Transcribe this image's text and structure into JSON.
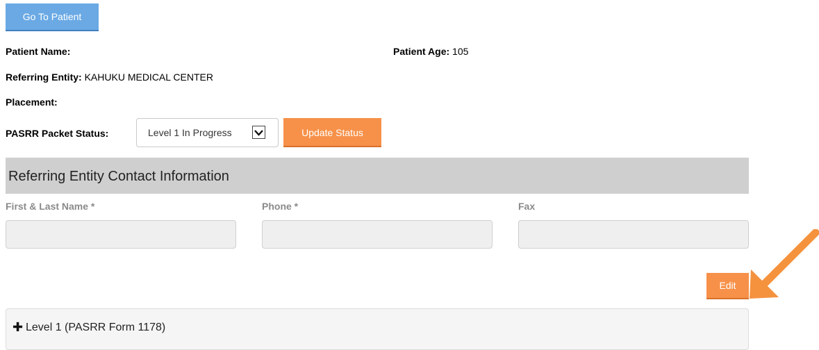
{
  "top": {
    "go_to_patient": "Go To Patient"
  },
  "patient": {
    "name_label": "Patient Name:",
    "name_value": "",
    "age_label": "Patient Age:",
    "age_value": "105",
    "referring_label": "Referring Entity:",
    "referring_value": "KAHUKU MEDICAL CENTER",
    "placement_label": "Placement:",
    "placement_value": ""
  },
  "status": {
    "label": "PASRR Packet Status:",
    "selected": "Level 1 In Progress",
    "update_button": "Update Status"
  },
  "contact": {
    "title": "Referring Entity Contact Information",
    "fields": [
      {
        "label": "First & Last Name *",
        "value": ""
      },
      {
        "label": "Phone *",
        "value": ""
      },
      {
        "label": "Fax",
        "value": ""
      }
    ],
    "edit_button": "Edit"
  },
  "accordion": {
    "level1_label": "Level 1 (PASRR Form 1178)"
  },
  "colors": {
    "primary_blue": "#6aa9e4",
    "accent_orange": "#f79149",
    "section_gray": "#cfcfcf"
  },
  "icons": [
    "chevron-down-icon",
    "plus-icon",
    "arrow-annotation-icon"
  ]
}
